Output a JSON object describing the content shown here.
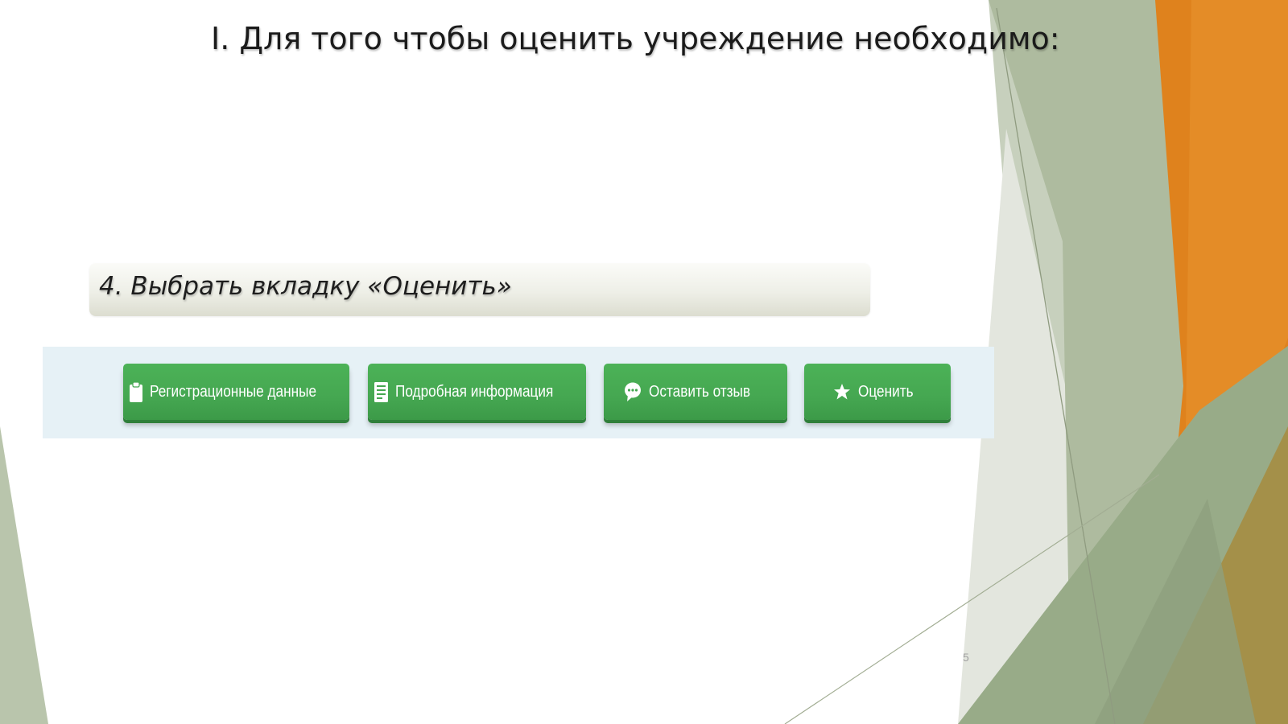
{
  "slide": {
    "title": "I. Для того чтобы оценить учреждение необходимо:",
    "step_text": "4. Выбрать вкладку «Оценить»",
    "page_number": "5"
  },
  "tabs": [
    {
      "label": "Регистрационные данные",
      "icon": "clipboard-icon"
    },
    {
      "label": "Подробная информация",
      "icon": "document-icon"
    },
    {
      "label": "Оставить отзыв",
      "icon": "speech-bubble-icon"
    },
    {
      "label": "Оценить",
      "icon": "star-icon"
    }
  ],
  "colors": {
    "button_green": "#45a751",
    "panel_background": "#e6f1f6",
    "accent_orange": "#e0831f",
    "accent_sage": "#a7b697"
  }
}
